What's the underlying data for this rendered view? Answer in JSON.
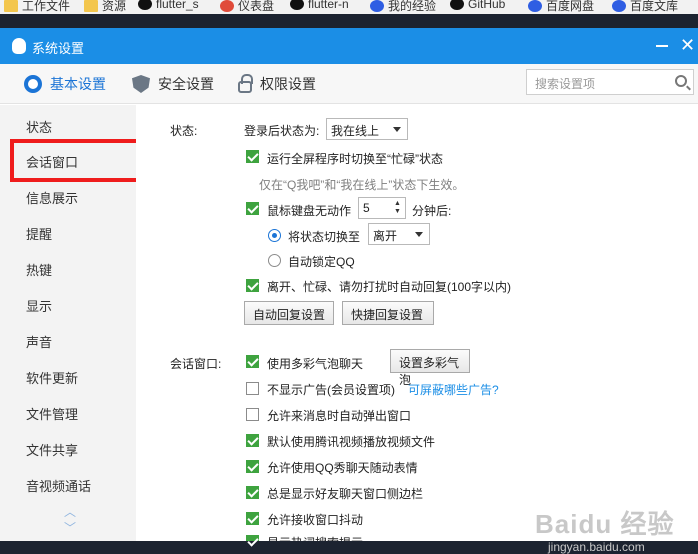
{
  "bookmarks": [
    {
      "label": "工作文件",
      "icon": "folder-icon"
    },
    {
      "label": "资源",
      "icon": "folder-icon"
    },
    {
      "label": "flutter_s",
      "icon": "github-icon"
    },
    {
      "label": "仪表盘",
      "icon": "dashboard-icon"
    },
    {
      "label": "flutter-n",
      "icon": "github-icon"
    },
    {
      "label": "我的经验",
      "icon": "baidu-paw-icon"
    },
    {
      "label": "GitHub",
      "icon": "github-icon"
    },
    {
      "label": "百度网盘",
      "icon": "baidu-paw-icon"
    },
    {
      "label": "百度文库",
      "icon": "baidu-paw-icon"
    }
  ],
  "window": {
    "title": "系统设置"
  },
  "tabs": [
    {
      "label": "基本设置",
      "icon": "gear-icon",
      "active": true
    },
    {
      "label": "安全设置",
      "icon": "shield-icon",
      "active": false
    },
    {
      "label": "权限设置",
      "icon": "lock-icon",
      "active": false
    }
  ],
  "search": {
    "placeholder": "搜索设置项"
  },
  "sidebar": {
    "items": [
      {
        "label": "状态"
      },
      {
        "label": "会话窗口"
      },
      {
        "label": "信息展示"
      },
      {
        "label": "提醒"
      },
      {
        "label": "热键"
      },
      {
        "label": "显示"
      },
      {
        "label": "声音"
      },
      {
        "label": "软件更新"
      },
      {
        "label": "文件管理"
      },
      {
        "label": "文件共享"
      },
      {
        "label": "音视频通话"
      }
    ],
    "up_arrow": "︿",
    "down_arrow": "﹀"
  },
  "status_section": {
    "label": "状态:",
    "login_status_label": "登录后状态为:",
    "login_status_value": "我在线上",
    "fullscreen_busy": "运行全屏程序时切换至“忙碌”状态",
    "fullscreen_hint": "仅在“Q我吧”和“我在线上”状态下生效。",
    "idle_prefix": "鼠标键盘无动作",
    "idle_minutes": "5",
    "idle_suffix": "分钟后:",
    "switch_status_label": "将状态切换至",
    "switch_status_value": "离开",
    "auto_lock": "自动锁定QQ",
    "auto_reply": "离开、忙碌、请勿打扰时自动回复(100字以内)",
    "auto_reply_settings": "自动回复设置",
    "quick_reply_settings": "快捷回复设置"
  },
  "chat_section": {
    "label": "会话窗口:",
    "colorful_bubble": "使用多彩气泡聊天",
    "bubble_settings": "设置多彩气泡",
    "no_ads": "不显示广告(会员设置项)",
    "ads_link": "可屏蔽哪些广告?",
    "auto_popup": "允许来消息时自动弹出窗口",
    "tencent_video": "默认使用腾讯视频播放视频文件",
    "qq_show": "允许使用QQ秀聊天随动表情",
    "sidebar_show": "总是显示好友聊天窗口侧边栏",
    "shake": "允许接收窗口抖动",
    "hot_search": "显示热词搜索提示"
  },
  "watermark": {
    "text": "Baidu 经验",
    "sub": "jingyan.baidu.com"
  }
}
